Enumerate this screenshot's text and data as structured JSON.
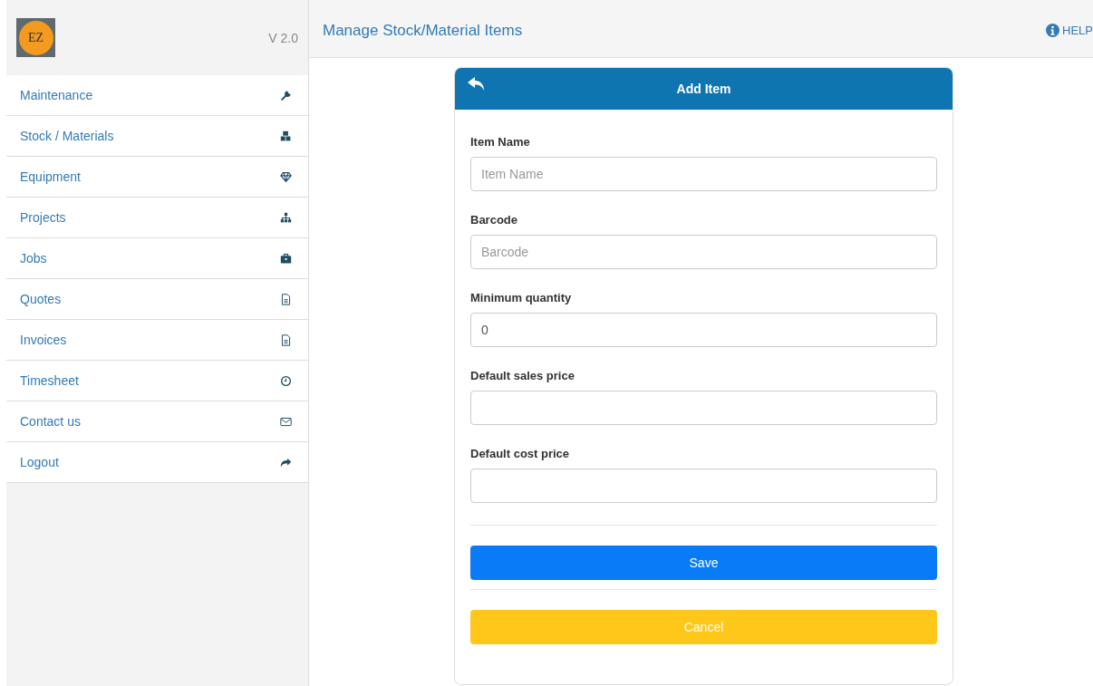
{
  "sidebar": {
    "logo_text": "EZ",
    "version": "V 2.0",
    "items": [
      {
        "label": "Maintenance"
      },
      {
        "label": "Stock / Materials"
      },
      {
        "label": "Equipment"
      },
      {
        "label": "Projects"
      },
      {
        "label": "Jobs"
      },
      {
        "label": "Quotes"
      },
      {
        "label": "Invoices"
      },
      {
        "label": "Timesheet"
      },
      {
        "label": "Contact us"
      },
      {
        "label": "Logout"
      }
    ]
  },
  "header": {
    "title": "Manage Stock/Material Items",
    "help": "HELP"
  },
  "card": {
    "title": "Add Item",
    "fields": [
      {
        "label": "Item Name",
        "placeholder": "Item Name"
      },
      {
        "label": "Barcode",
        "placeholder": "Barcode"
      },
      {
        "label": "Minimum quantity",
        "value": "0"
      },
      {
        "label": "Default sales price"
      },
      {
        "label": "Default cost price"
      }
    ],
    "buttons": [
      {
        "label": "Save",
        "kind": "primary"
      },
      {
        "label": "Cancel",
        "kind": "warning"
      }
    ]
  }
}
